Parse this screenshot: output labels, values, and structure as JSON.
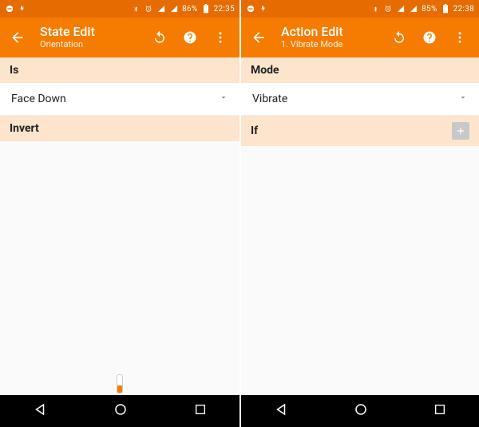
{
  "left": {
    "statusbar": {
      "battery_pct": "86%",
      "time": "22:35"
    },
    "appbar": {
      "title": "State Edit",
      "subtitle": "Orientation"
    },
    "sections": {
      "is": {
        "label": "Is",
        "value": "Face Down"
      },
      "invert": {
        "label": "Invert"
      }
    }
  },
  "right": {
    "statusbar": {
      "battery_pct": "85%",
      "time": "22:38"
    },
    "appbar": {
      "title": "Action Edit",
      "subtitle": "1. Vibrate Mode"
    },
    "sections": {
      "mode": {
        "label": "Mode",
        "value": "Vibrate"
      },
      "if": {
        "label": "If"
      }
    }
  }
}
